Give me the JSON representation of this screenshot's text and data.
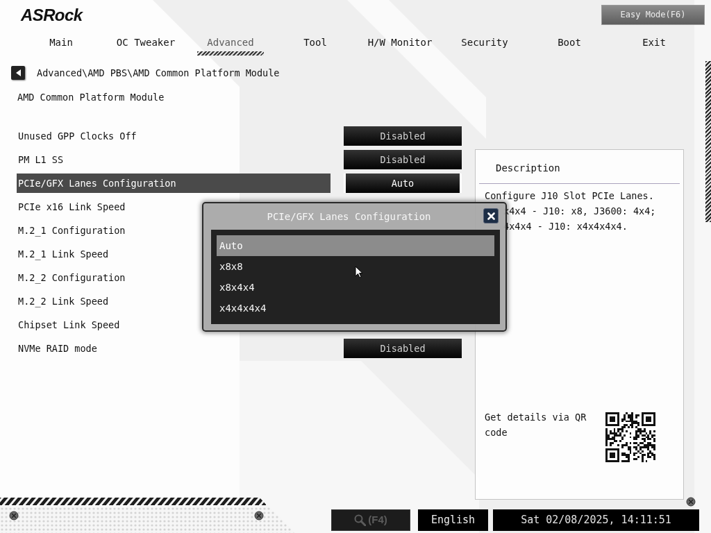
{
  "logo": "ASRock",
  "easy_mode_button": "Easy Mode(F6)",
  "tabs": [
    {
      "label": "Main",
      "selected": false
    },
    {
      "label": "OC Tweaker",
      "selected": false
    },
    {
      "label": "Advanced",
      "selected": true
    },
    {
      "label": "Tool",
      "selected": false
    },
    {
      "label": "H/W Monitor",
      "selected": false
    },
    {
      "label": "Security",
      "selected": false
    },
    {
      "label": "Boot",
      "selected": false
    },
    {
      "label": "Exit",
      "selected": false
    }
  ],
  "breadcrumb": "Advanced\\AMD PBS\\AMD Common Platform Module",
  "page_title": "AMD Common Platform Module",
  "settings": [
    {
      "label": "Unused GPP Clocks Off",
      "value": "Disabled",
      "selected": false
    },
    {
      "label": "PM L1 SS",
      "value": "Disabled",
      "selected": false
    },
    {
      "label": "PCIe/GFX Lanes Configuration",
      "value": "Auto",
      "selected": true
    },
    {
      "label": "PCIe x16 Link Speed",
      "selected": false
    },
    {
      "label": "M.2_1 Configuration",
      "selected": false
    },
    {
      "label": "M.2_1 Link Speed",
      "selected": false
    },
    {
      "label": "M.2_2 Configuration",
      "selected": false
    },
    {
      "label": "M.2_2 Link Speed",
      "selected": false
    },
    {
      "label": "Chipset Link Speed",
      "selected": false
    },
    {
      "label": "NVMe RAID mode",
      "value": "Disabled",
      "selected": false
    }
  ],
  "dialog": {
    "title": "PCIe/GFX Lanes Configuration",
    "options": [
      {
        "label": "Auto",
        "selected": true
      },
      {
        "label": "x8x8",
        "selected": false
      },
      {
        "label": "x8x4x4",
        "selected": false
      },
      {
        "label": "x4x4x4x4",
        "selected": false
      }
    ]
  },
  "description": {
    "title": "Description",
    "lines": [
      {
        "text": "Configure J10 Slot PCIe Lanes.",
        "covered": false
      },
      {
        "text": "x4x4 - J10: x8, J3600: 4x4;",
        "covered": true
      },
      {
        "text": "4x4x4 - J10: x4x4x4x4.",
        "covered": true
      }
    ],
    "qr_caption": "Get details via QR code"
  },
  "footer": {
    "search_button": {
      "label": "(F4)",
      "disabled": true
    },
    "language_button": "English",
    "datetime": "Sat 02/08/2025, 14:11:51"
  }
}
